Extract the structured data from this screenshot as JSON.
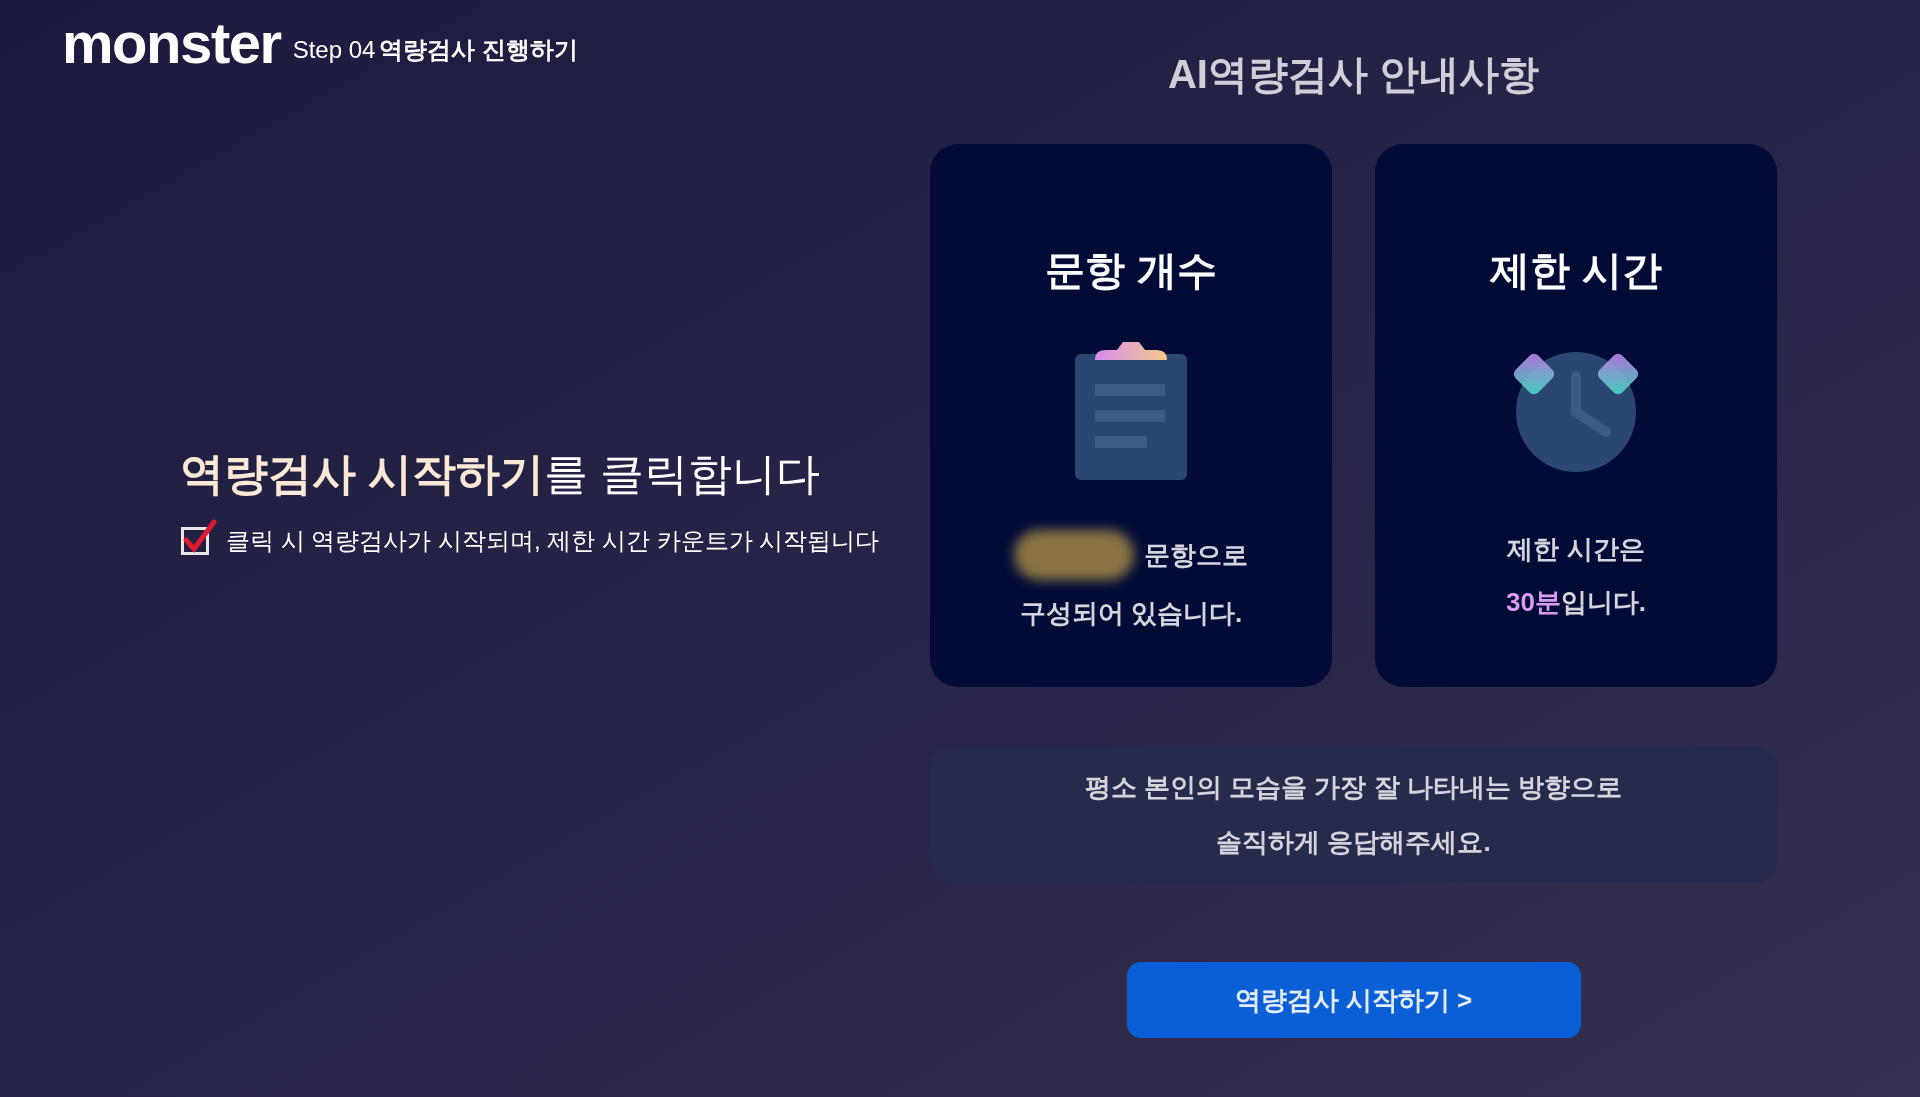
{
  "header": {
    "logo": "monster",
    "step_label": "Step 04",
    "step_title": "역량검사 진행하기"
  },
  "instruction": {
    "heading": "**역량검사 시작하기**를 클릭합니다",
    "checked": true,
    "note": "클릭 시 역량검사가 시작되며, 제한 시간 카운트가 시작됩니다"
  },
  "guide": {
    "title": "AI역량검사 안내사항",
    "cards": [
      {
        "kind": "clipboard",
        "title": "문항 개수",
        "redacted": true,
        "lines": [
          {
            "text": "문항으로"
          },
          {
            "text": "구성되어 있습니다."
          }
        ]
      },
      {
        "kind": "clock",
        "title": "제한 시간",
        "redacted": false,
        "lines": [
          {
            "text": "제한 시간은"
          },
          {
            "highlight": "30분",
            "text": "입니다."
          }
        ]
      }
    ],
    "notice": [
      "평소 본인의 모습을 가장 잘 나타내는 방향으로",
      "솔직하게 응답해주세요."
    ],
    "start_button": "역량검사 시작하기 >"
  }
}
